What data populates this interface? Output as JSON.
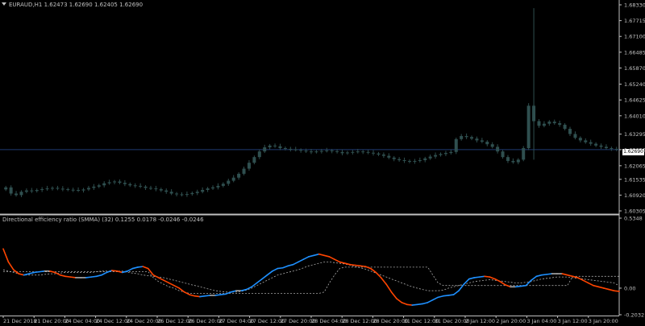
{
  "window": {
    "symbol_line": "EURAUD,H1  1.62473 1.62690 1.62405 1.62690",
    "current_price": "1.62690"
  },
  "indicator": {
    "header": "Directional efficiency ratio (SMMA) (32) 0.1255 0.0178 -0.0246 -0.0246"
  },
  "colors": {
    "background": "#000000",
    "axis": "#c0c0c0",
    "candle": "#2f4f4f",
    "bid_line": "#1f3a73",
    "ratio_up": "#1e90ff",
    "ratio_down": "#ff4500",
    "ratio_flat": "#a9a9a9",
    "levels": "#a9a9a9"
  },
  "chart_data": [
    {
      "type": "candlestick",
      "title": "EURAUD,H1",
      "ylim": [
        1.60305,
        1.6833
      ],
      "y_ticks": [
        "1.68330",
        "1.67715",
        "1.67100",
        "1.66485",
        "1.65870",
        "1.65240",
        "1.64625",
        "1.64010",
        "1.63295",
        "1.62690",
        "1.62065",
        "1.61535",
        "1.60920",
        "1.60305"
      ],
      "x_ticks": [
        "21 Dec 2018",
        "21 Dec 20:00",
        "24 Dec 04:00",
        "24 Dec 12:00",
        "24 Dec 20:00",
        "26 Dec 12:00",
        "26 Dec 20:00",
        "27 Dec 04:00",
        "27 Dec 12:00",
        "27 Dec 20:00",
        "28 Dec 04:00",
        "28 Dec 12:00",
        "28 Dec 20:00",
        "31 Dec 12:00",
        "31 Dec 20:00",
        "2 Jan 12:00",
        "2 Jan 20:00",
        "3 Jan 04:00",
        "3 Jan 12:00",
        "3 Jan 20:00"
      ],
      "closes": [
        1.6122,
        1.6098,
        1.6092,
        1.6105,
        1.611,
        1.6108,
        1.6112,
        1.6115,
        1.6118,
        1.612,
        1.6117,
        1.6115,
        1.6113,
        1.6112,
        1.611,
        1.6114,
        1.612,
        1.6125,
        1.613,
        1.6138,
        1.6142,
        1.6145,
        1.614,
        1.6135,
        1.613,
        1.6128,
        1.6125,
        1.612,
        1.6118,
        1.6115,
        1.611,
        1.6105,
        1.6098,
        1.6095,
        1.6093,
        1.6096,
        1.61,
        1.6105,
        1.6112,
        1.6118,
        1.6122,
        1.6128,
        1.6136,
        1.6148,
        1.616,
        1.6175,
        1.6195,
        1.6218,
        1.624,
        1.6262,
        1.6278,
        1.6285,
        1.6282,
        1.6275,
        1.6272,
        1.627,
        1.6268,
        1.6265,
        1.6262,
        1.626,
        1.6262,
        1.6264,
        1.6266,
        1.6263,
        1.626,
        1.6255,
        1.6258,
        1.626,
        1.6262,
        1.626,
        1.6257,
        1.6254,
        1.625,
        1.6245,
        1.6238,
        1.6232,
        1.6228,
        1.6225,
        1.6222,
        1.6225,
        1.6228,
        1.6235,
        1.6242,
        1.6248,
        1.6252,
        1.6256,
        1.626,
        1.631,
        1.6322,
        1.6318,
        1.6312,
        1.6305,
        1.63,
        1.629,
        1.628,
        1.6262,
        1.624,
        1.6225,
        1.622,
        1.623,
        1.6275,
        1.644,
        1.638,
        1.6362,
        1.637,
        1.6378,
        1.6372,
        1.6366,
        1.635,
        1.633,
        1.6315,
        1.6305,
        1.6298,
        1.6292,
        1.6285,
        1.628,
        1.6275,
        1.6272,
        1.6269
      ]
    },
    {
      "type": "line",
      "title": "Directional efficiency ratio (SMMA) (32)",
      "ylim": [
        -0.2032,
        0.5348
      ],
      "y_ticks": [
        "0.5348",
        "0.00",
        "-0.2032"
      ],
      "series": [
        {
          "values": [
            0.3,
            0.2,
            0.14,
            0.11,
            0.1,
            0.11,
            0.12,
            0.125,
            0.13,
            0.13,
            0.12,
            0.1,
            0.09,
            0.085,
            0.08,
            0.08,
            0.08,
            0.085,
            0.09,
            0.1,
            0.12,
            0.135,
            0.13,
            0.12,
            0.13,
            0.15,
            0.16,
            0.165,
            0.15,
            0.1,
            0.08,
            0.06,
            0.04,
            0.02,
            0.0,
            -0.03,
            -0.05,
            -0.06,
            -0.065,
            -0.06,
            -0.055,
            -0.055,
            -0.05,
            -0.045,
            -0.03,
            -0.02,
            -0.02,
            -0.01,
            0.01,
            0.04,
            0.07,
            0.1,
            0.13,
            0.15,
            0.155,
            0.17,
            0.18,
            0.2,
            0.22,
            0.24,
            0.25,
            0.26,
            0.25,
            0.24,
            0.22,
            0.2,
            0.19,
            0.18,
            0.175,
            0.17,
            0.165,
            0.15,
            0.12,
            0.08,
            0.03,
            -0.03,
            -0.08,
            -0.11,
            -0.125,
            -0.13,
            -0.125,
            -0.12,
            -0.11,
            -0.09,
            -0.07,
            -0.06,
            -0.055,
            -0.05,
            -0.02,
            0.03,
            0.07,
            0.08,
            0.085,
            0.09,
            0.085,
            0.07,
            0.05,
            0.025,
            0.01,
            0.01,
            0.015,
            0.02,
            0.06,
            0.09,
            0.1,
            0.105,
            0.11,
            0.11,
            0.11,
            0.1,
            0.09,
            0.08,
            0.06,
            0.04,
            0.02,
            0.01,
            0.0,
            -0.01,
            -0.02,
            -0.0246
          ]
        },
        {
          "values": [
            0.14,
            0.13,
            0.12,
            0.11,
            0.1,
            0.1,
            0.1,
            0.1,
            0.105,
            0.11,
            0.11,
            0.115,
            0.12,
            0.12,
            0.12,
            0.12,
            0.12,
            0.12,
            0.125,
            0.13,
            0.13,
            0.13,
            0.13,
            0.13,
            0.12,
            0.115,
            0.11,
            0.1,
            0.095,
            0.09,
            0.085,
            0.08,
            0.07,
            0.06,
            0.05,
            0.04,
            0.03,
            0.02,
            0.01,
            0.0,
            -0.01,
            -0.02,
            -0.025,
            -0.03,
            -0.03,
            -0.03,
            -0.025,
            -0.015,
            0.0,
            0.02,
            0.04,
            0.06,
            0.08,
            0.1,
            0.11,
            0.12,
            0.13,
            0.14,
            0.155,
            0.17,
            0.18,
            0.19,
            0.2,
            0.2,
            0.195,
            0.19,
            0.185,
            0.175,
            0.165,
            0.155,
            0.145,
            0.13,
            0.115,
            0.1,
            0.085,
            0.07,
            0.055,
            0.04,
            0.025,
            0.01,
            0.0,
            -0.01,
            -0.02,
            -0.02,
            -0.02,
            -0.015,
            0.0,
            0.01,
            0.02,
            0.03,
            0.04,
            0.05,
            0.055,
            0.06,
            0.065,
            0.06,
            0.055,
            0.05,
            0.045,
            0.04,
            0.04,
            0.045,
            0.05,
            0.06,
            0.07,
            0.075,
            0.08,
            0.085,
            0.085,
            0.085,
            0.08,
            0.075,
            0.07,
            0.065,
            0.06,
            0.055,
            0.05,
            0.045,
            0.04,
            0.0178
          ]
        },
        {
          "values": [
            0.125,
            0.125,
            0.125,
            0.125,
            0.125,
            0.125,
            0.125,
            0.125,
            0.125,
            0.125,
            0.125,
            0.125,
            0.125,
            0.125,
            0.125,
            0.125,
            0.125,
            0.125,
            0.125,
            0.125,
            0.125,
            0.125,
            0.125,
            0.125,
            0.125,
            0.125,
            0.125,
            0.125,
            0.125,
            0.08,
            0.05,
            0.03,
            0.01,
            0.0,
            -0.02,
            -0.03,
            -0.04,
            -0.04,
            -0.04,
            -0.04,
            -0.04,
            -0.04,
            -0.04,
            -0.04,
            -0.04,
            -0.04,
            -0.04,
            -0.04,
            -0.04,
            -0.04,
            -0.04,
            -0.04,
            -0.04,
            -0.04,
            -0.04,
            -0.04,
            -0.04,
            -0.04,
            -0.04,
            -0.04,
            -0.04,
            -0.04,
            -0.03,
            0.04,
            0.1,
            0.15,
            0.16,
            0.16,
            0.16,
            0.16,
            0.16,
            0.16,
            0.16,
            0.16,
            0.16,
            0.16,
            0.16,
            0.16,
            0.16,
            0.16,
            0.16,
            0.16,
            0.16,
            0.1,
            0.04,
            0.02,
            0.02,
            0.02,
            0.02,
            0.02,
            0.02,
            0.02,
            0.02,
            0.02,
            0.02,
            0.02,
            0.02,
            0.02,
            0.02,
            0.02,
            0.02,
            0.02,
            0.02,
            0.02,
            0.02,
            0.02,
            0.02,
            0.02,
            0.02,
            0.02,
            0.09,
            0.09,
            0.09,
            0.09,
            0.09,
            0.09,
            0.09,
            0.09,
            0.09,
            0.09
          ]
        },
        {
          "values": [
            0.0,
            0.0,
            0.0,
            0.0,
            0.0,
            0.0,
            0.0,
            0.0,
            0.0,
            0.0,
            0.0,
            0.0,
            0.0,
            0.0,
            0.0,
            0.0,
            0.0,
            0.0,
            0.0,
            0.0,
            0.0,
            0.0,
            0.0,
            0.0,
            0.0,
            0.0,
            0.0,
            0.0,
            0.0,
            0.0,
            0.0,
            0.0,
            0.0,
            0.0,
            0.0,
            0.0,
            0.0,
            0.0,
            0.0,
            0.0,
            0.0,
            0.0,
            0.0,
            0.0,
            0.0,
            0.0,
            0.0,
            0.0,
            0.0,
            0.0,
            0.0,
            0.0,
            0.0,
            0.0,
            0.0,
            0.0,
            0.0,
            0.0,
            0.0,
            0.0,
            0.0,
            0.0,
            0.0,
            0.0,
            0.0,
            0.0,
            0.0,
            0.0,
            0.0,
            0.0,
            0.0,
            0.0,
            0.0,
            0.0,
            0.0,
            0.0,
            0.0,
            0.0,
            0.0,
            0.0,
            0.0,
            0.0,
            0.0,
            0.0,
            0.0,
            0.0,
            0.0,
            0.0,
            0.0,
            0.0,
            0.0,
            0.0,
            0.0,
            0.0,
            0.0,
            0.0,
            0.0,
            0.0,
            0.0,
            0.0,
            0.0,
            0.0,
            0.0,
            0.0,
            0.0,
            0.0,
            0.0,
            0.0,
            0.0,
            0.0,
            0.0,
            0.0,
            0.0,
            0.0,
            0.0,
            0.0,
            0.0,
            0.0,
            0.0,
            0.0
          ]
        }
      ]
    }
  ]
}
